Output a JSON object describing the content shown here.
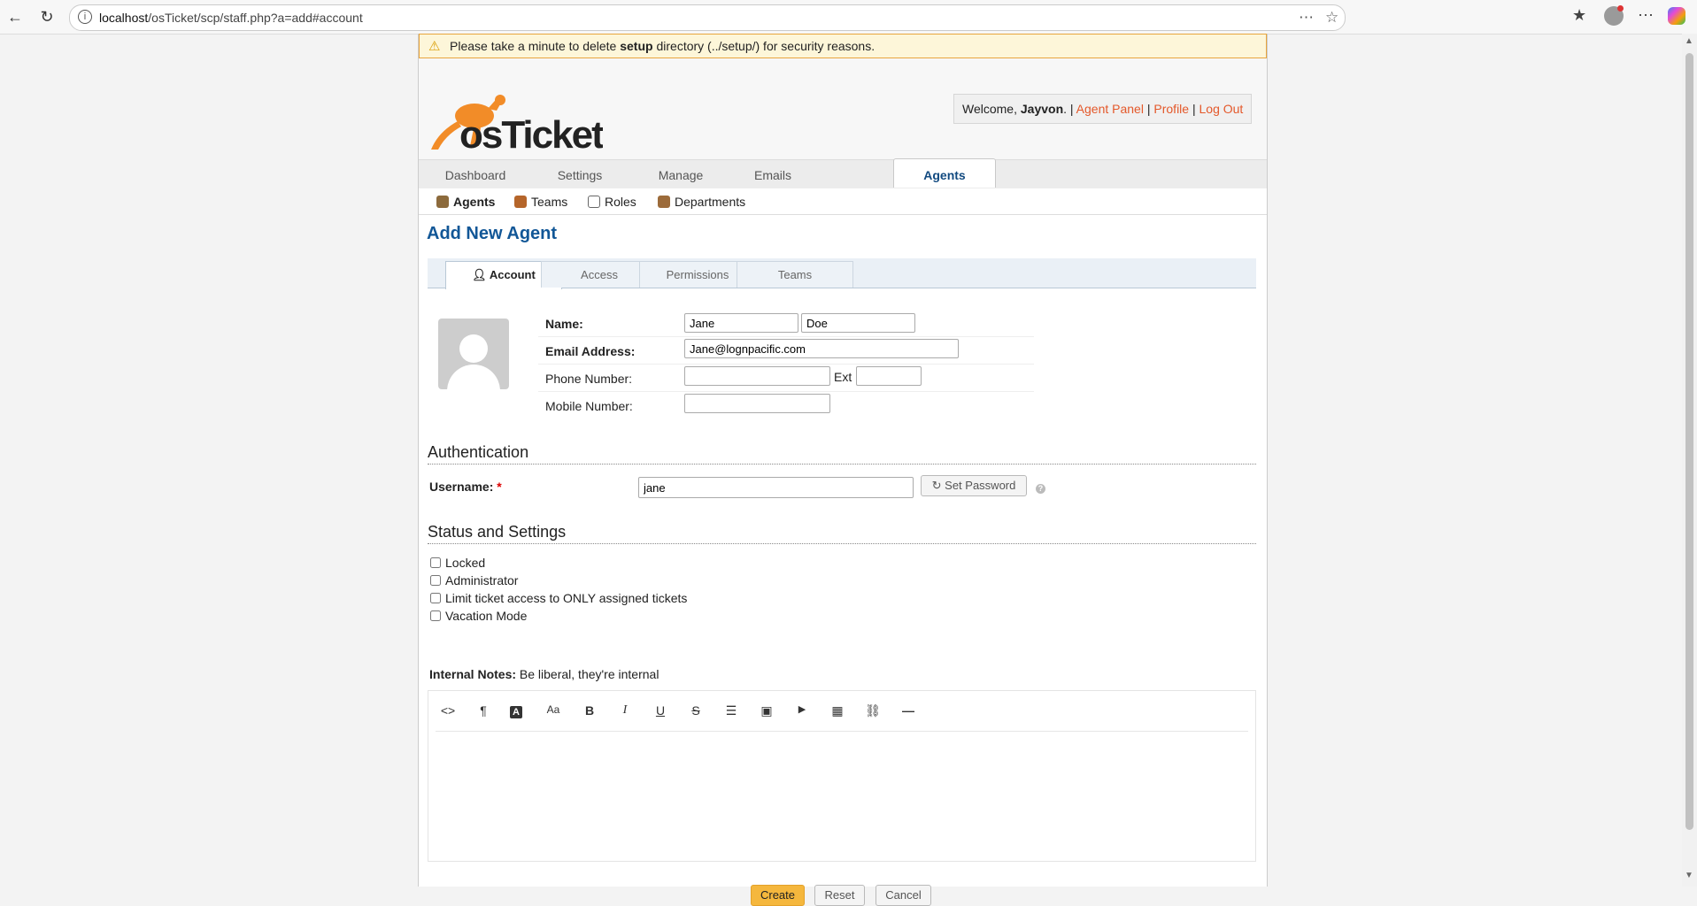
{
  "browser": {
    "url_host": "localhost",
    "url_path": "/osTicket/scp/staff.php?a=add#account"
  },
  "warning": {
    "pre": "Please take a minute to delete ",
    "strong": "setup",
    "post": " directory (../setup/) for security reasons."
  },
  "header": {
    "welcome_pre": "Welcome, ",
    "user": "Jayvon",
    "welcome_post": ". | ",
    "agent_panel": "Agent Panel",
    "profile": "Profile",
    "logout": "Log Out",
    "sep": " | ",
    "logo_text": "osTicket"
  },
  "nav": {
    "tabs": [
      "Dashboard",
      "Settings",
      "Manage",
      "Emails",
      "Agents"
    ]
  },
  "subnav": {
    "items": [
      "Agents",
      "Teams",
      "Roles",
      "Departments"
    ]
  },
  "page_title": "Add New Agent",
  "form_tabs": [
    "Account",
    "Access",
    "Permissions",
    "Teams"
  ],
  "account": {
    "name_label": "Name:",
    "first_name": "Jane",
    "last_name": "Doe",
    "email_label": "Email Address:",
    "email": "Jane@lognpacific.com",
    "phone_label": "Phone Number:",
    "phone": "",
    "ext_label": "Ext",
    "ext": "",
    "mobile_label": "Mobile Number:",
    "mobile": ""
  },
  "auth": {
    "heading": "Authentication",
    "username_label": "Username:",
    "required_mark": "*",
    "username": "jane",
    "set_password": "Set Password",
    "help": "?"
  },
  "status": {
    "heading": "Status and Settings",
    "options": [
      "Locked",
      "Administrator",
      "Limit ticket access to ONLY assigned tickets",
      "Vacation Mode"
    ]
  },
  "notes": {
    "label": "Internal Notes:",
    "hint": "Be liberal, they're internal"
  },
  "editor_tools": [
    {
      "icon": "code-icon",
      "glyph": "<>"
    },
    {
      "icon": "paragraph-icon",
      "glyph": "¶"
    },
    {
      "icon": "text-color-icon",
      "glyph": "A"
    },
    {
      "icon": "font-size-icon",
      "glyph": "Aa"
    },
    {
      "icon": "bold-icon",
      "glyph": "B"
    },
    {
      "icon": "italic-icon",
      "glyph": "I"
    },
    {
      "icon": "underline-icon",
      "glyph": "U"
    },
    {
      "icon": "strikethrough-icon",
      "glyph": "S"
    },
    {
      "icon": "list-icon",
      "glyph": "☰"
    },
    {
      "icon": "image-icon",
      "glyph": "▣"
    },
    {
      "icon": "video-icon",
      "glyph": "▶"
    },
    {
      "icon": "table-icon",
      "glyph": "▦"
    },
    {
      "icon": "link-icon",
      "glyph": "⛓"
    },
    {
      "icon": "horizontal-rule-icon",
      "glyph": "—"
    }
  ],
  "buttons": {
    "create": "Create",
    "reset": "Reset",
    "cancel": "Cancel"
  },
  "colors": {
    "accent_blue": "#125797",
    "link_orange": "#e4582a",
    "warning_bg": "#fdf6d9",
    "primary_button": "#f5b73d"
  }
}
